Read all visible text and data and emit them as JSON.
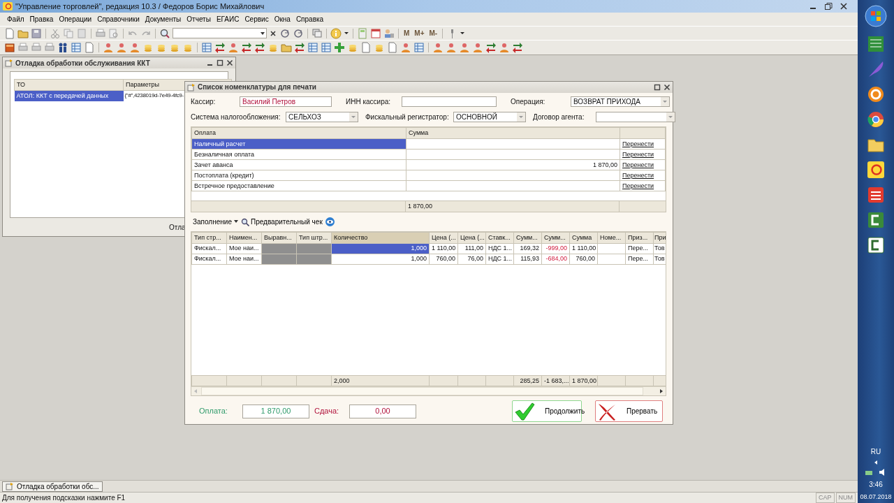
{
  "app": {
    "title": "\"Управление торговлей\", редакция 10.3 / Федоров Борис Михайлович",
    "menu": [
      "Файл",
      "Правка",
      "Операции",
      "Справочники",
      "Документы",
      "Отчеты",
      "ЕГАИС",
      "Сервис",
      "Окна",
      "Справка"
    ],
    "memory_buttons": [
      "M",
      "M+",
      "M-"
    ]
  },
  "debug_window": {
    "title": "Отладка обработки обслуживания ККТ",
    "columns": [
      "ТО",
      "Параметры"
    ],
    "rows": [
      {
        "cells": [
          "АТОЛ: ККТ с передачей данных",
          "{\"#\",4238019d-7e49-4fc9-"
        ],
        "selected": true
      }
    ],
    "button": "Отла"
  },
  "dialog": {
    "title": "Список номенклатуры для печати",
    "fields": [
      {
        "label": "Кассир:",
        "value": "Василий Петров",
        "kind": "input",
        "highlighted": true
      },
      {
        "label": "ИНН кассира:",
        "kind": "input"
      },
      {
        "label": "Операция:",
        "value": "ВОЗВРАТ ПРИХОДА",
        "kind": "select",
        "highlighted": false
      },
      {
        "label": "Система налогообложения:",
        "value": "СЕЛЬХОЗ",
        "kind": "select",
        "highlighted": false
      },
      {
        "label": "Фискальный регистратор:",
        "value": "ОСНОВНОЙ",
        "kind": "select",
        "highlighted": false
      },
      {
        "label": "Договор агента:",
        "kind": "select"
      }
    ],
    "payments": {
      "columns": [
        "Оплата",
        "Сумма"
      ],
      "rows": [
        {
          "name": "Наличный расчет",
          "link": "Перенести",
          "selected": true
        },
        {
          "name": "Безналичная оплата",
          "link": "Перенести",
          "selected": false
        },
        {
          "name": "Зачет аванса",
          "sum": "1 870,00",
          "link": "Перенести",
          "selected": false
        },
        {
          "name": "Постоплата (кредит)",
          "link": "Перенести",
          "selected": false
        },
        {
          "name": "Встречное предоставление",
          "link": "Перенести",
          "selected": false
        }
      ],
      "total": "1 870,00"
    },
    "toolbar": {
      "fill_menu": "Заполнение",
      "preview": "Предварительный чек"
    },
    "items": {
      "columns": [
        {
          "label": "Тип стр...",
          "kind": "text",
          "current": false
        },
        {
          "label": "Наимен...",
          "kind": "text",
          "current": false
        },
        {
          "label": "Выравн...",
          "kind": "shaded",
          "current": false
        },
        {
          "label": "Тип штр...",
          "kind": "shaded",
          "current": false
        },
        {
          "label": "Количество",
          "kind": "number",
          "current": true,
          "total": "2,000"
        },
        {
          "label": "Цена (...",
          "kind": "number",
          "current": false
        },
        {
          "label": "Цена (...",
          "kind": "number",
          "current": false
        },
        {
          "label": "Ставк...",
          "kind": "text",
          "current": false
        },
        {
          "label": "Сумм...",
          "kind": "number",
          "current": false,
          "total": "285,25"
        },
        {
          "label": "Сумм...",
          "kind": "signed",
          "current": false,
          "total": "-1 683,..."
        },
        {
          "label": "Сумма",
          "kind": "number",
          "current": false,
          "total": "1 870,00"
        },
        {
          "label": "Номе...",
          "kind": "text",
          "current": false
        },
        {
          "label": "Приз...",
          "kind": "text",
          "current": false
        },
        {
          "label": "При",
          "kind": "text",
          "current": false
        }
      ],
      "rows": [
        {
          "cells": [
            "Фискал...",
            "Мое наи...",
            null,
            null,
            "1,000",
            "1 110,00",
            "111,00",
            "НДС 1...",
            "169,32",
            "-999,00",
            "1 110,00",
            null,
            "Пере...",
            "Тов"
          ],
          "selected": true
        },
        {
          "cells": [
            "Фискал...",
            "Мое наи...",
            null,
            null,
            "1,000",
            "760,00",
            "76,00",
            "НДС 1...",
            "115,93",
            "-684,00",
            "760,00",
            null,
            "Пере...",
            "Тов"
          ],
          "selected": false
        }
      ]
    },
    "payment": {
      "label": "Оплата:",
      "value": "1 870,00"
    },
    "change": {
      "label": "Сдача:",
      "value": "0,00"
    },
    "buttons": [
      {
        "label": "Продолжить",
        "kind": "confirm"
      },
      {
        "label": "Прервать",
        "kind": "cancel"
      }
    ]
  },
  "window_tabs": [
    {
      "label": "Отладка обработки обс...",
      "selected": true
    }
  ],
  "status_bar": {
    "hint": "Для получения подсказки нажмите F1",
    "indicators": [
      "CAP",
      "NUM"
    ]
  },
  "taskbar": {
    "language": "RU",
    "time": "3:46",
    "date": "08.07.2018"
  }
}
